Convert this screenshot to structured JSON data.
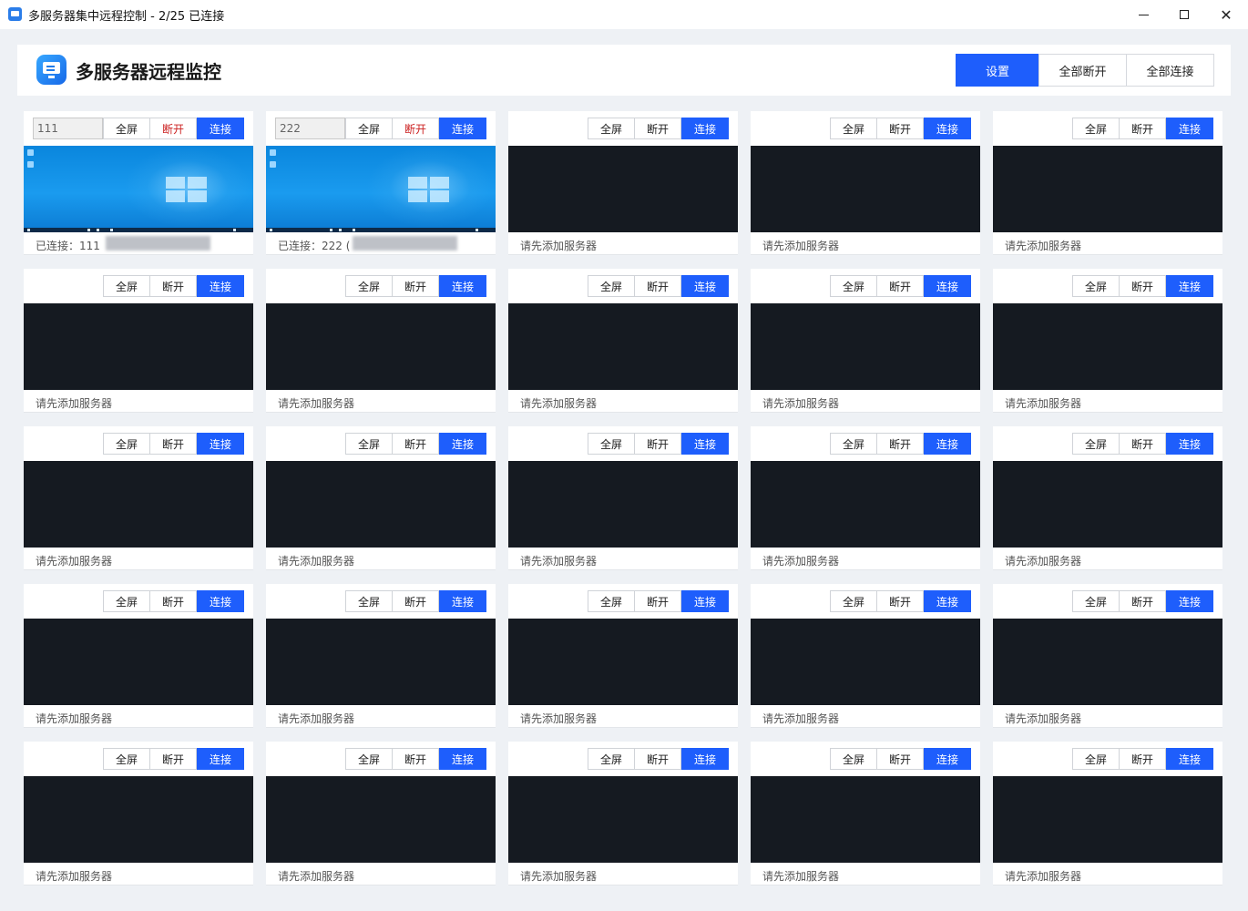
{
  "window": {
    "title": "多服务器集中远程控制 - 2/25 已连接",
    "minimize_icon": "minimize-icon",
    "maximize_icon": "maximize-icon",
    "close_icon": "close-icon"
  },
  "header": {
    "title": "多服务器远程监控",
    "buttons": {
      "settings": "设置",
      "disconnect_all": "全部断开",
      "connect_all": "全部连接"
    }
  },
  "colors": {
    "primary": "#1e5efc",
    "disconnect_active": "#cc2222",
    "screen_dark": "#151a21"
  },
  "card_labels": {
    "fullscreen": "全屏",
    "disconnect": "断开",
    "connect": "连接",
    "empty_status": "请先添加服务器"
  },
  "servers": [
    {
      "name": "111",
      "connected": true,
      "status": "已连接：111"
    },
    {
      "name": "222",
      "connected": true,
      "status": "已连接：222 ("
    }
  ]
}
